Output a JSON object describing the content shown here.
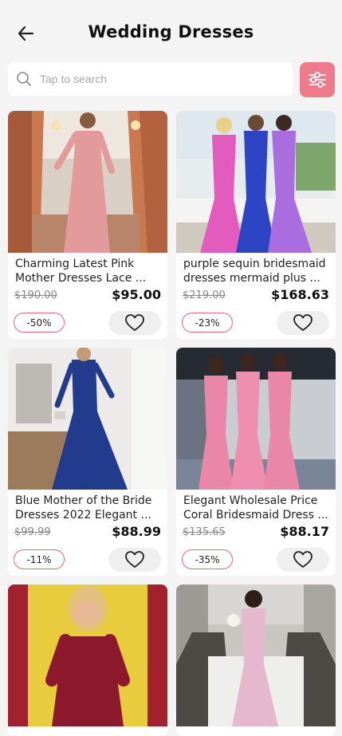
{
  "header": {
    "title": "Wedding Dresses",
    "back_icon": "arrow-left-icon"
  },
  "search": {
    "placeholder": "Tap to search",
    "icon": "search-icon",
    "filter_icon": "sliders-icon"
  },
  "colors": {
    "accent": "#ef7a8a",
    "badge_border": "#e8677c",
    "background": "#f4f4f4"
  },
  "products": [
    {
      "name": "Charming Latest Pink Mother Dresses Lace ...",
      "old_price": "$190.00",
      "price": "$95.00",
      "discount": "-50%"
    },
    {
      "name": "purple sequin bridesmaid dresses mermaid plus ...",
      "old_price": "$219.00",
      "price": "$168.63",
      "discount": "-23%"
    },
    {
      "name": "Blue Mother of the Bride Dresses 2022 Elegant ...",
      "old_price": "$99.99",
      "price": "$88.99",
      "discount": "-11%"
    },
    {
      "name": "Elegant Wholesale Price Coral Bridesmaid Dress ...",
      "old_price": "$135.65",
      "price": "$88.17",
      "discount": "-35%"
    },
    {
      "name": "",
      "old_price": "",
      "price": "",
      "discount": ""
    },
    {
      "name": "",
      "old_price": "",
      "price": "",
      "discount": ""
    }
  ]
}
